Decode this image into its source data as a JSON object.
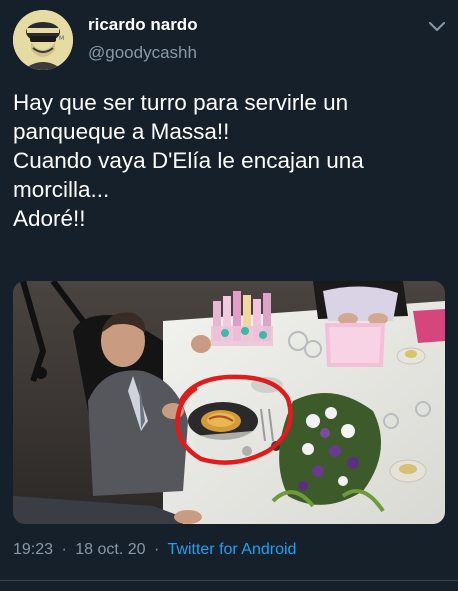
{
  "tweet": {
    "display_name": "ricardo nardo",
    "handle": "@goodycashh",
    "text_lines": [
      "Hay que ser turro para servirle un",
      "panqueque a Massa!!",
      "Cuando vaya D'Elía le encajan una",
      "morcilla...",
      "Adoré!!"
    ],
    "time": "19:23",
    "separator": "·",
    "date": "18 oct. 20",
    "source": "Twitter for Android"
  },
  "icons": {
    "more": "chevron-down-icon",
    "avatar": "cyclist-avatar"
  },
  "colors": {
    "background": "#15202b",
    "text": "#ffffff",
    "secondary": "#8899a6",
    "link": "#1da1f2",
    "highlight_circle": "#e01b1b"
  }
}
